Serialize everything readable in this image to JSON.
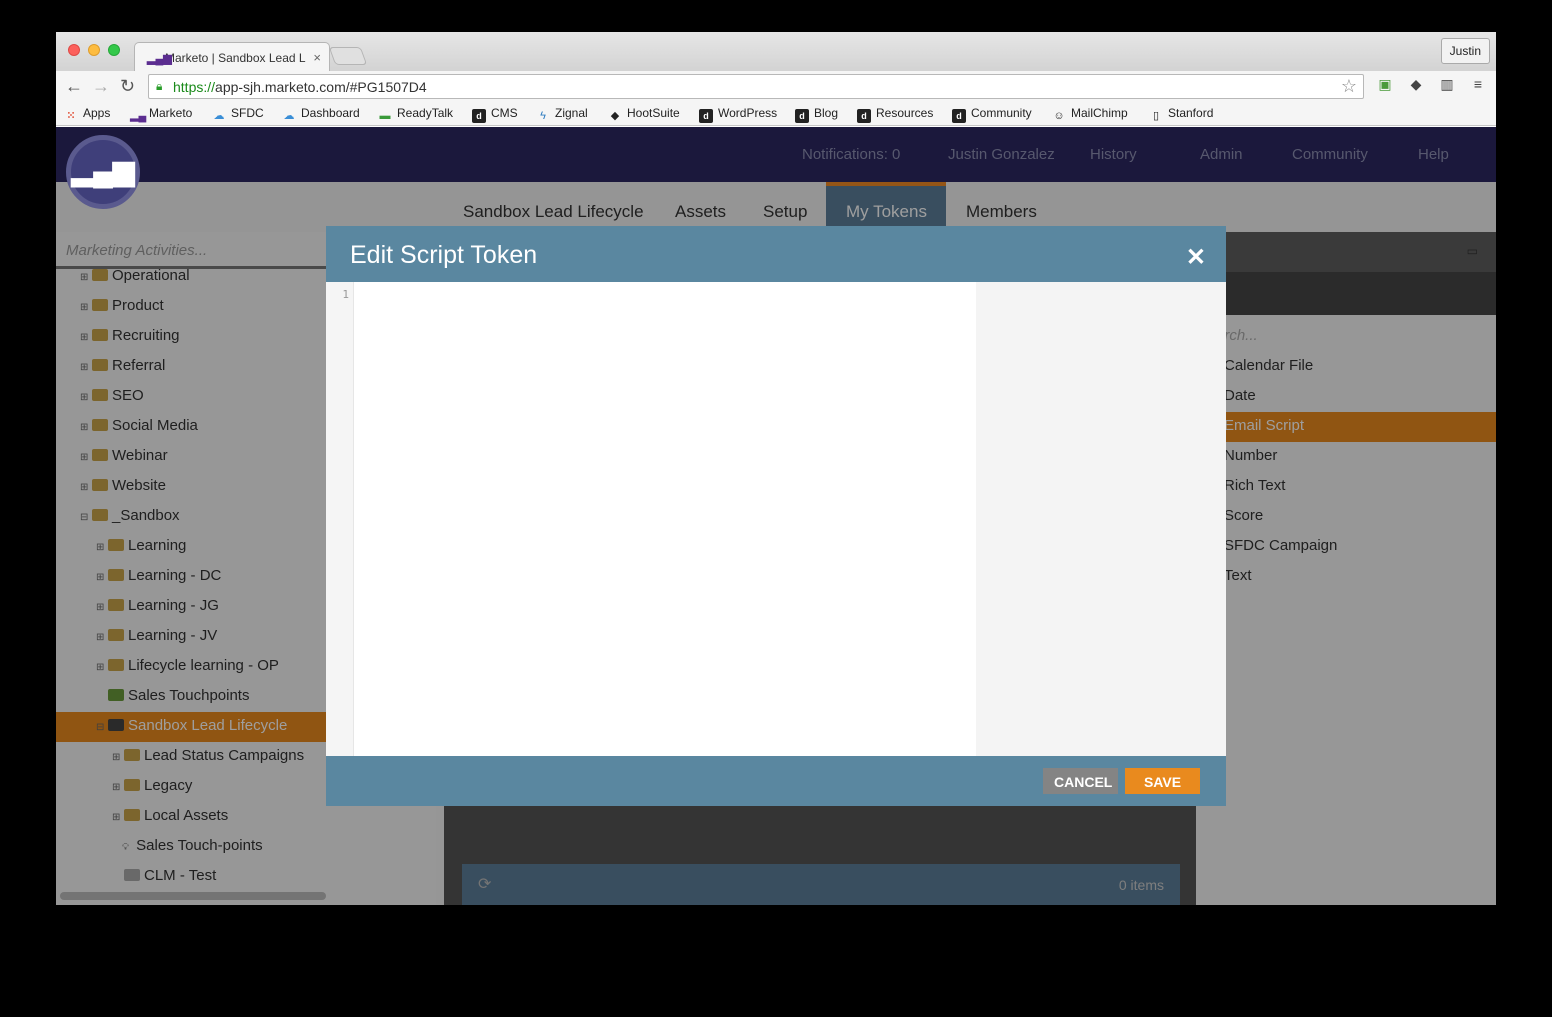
{
  "browser": {
    "tab_title": "Marketo | Sandbox Lead L",
    "tab_close": "×",
    "profile": "Justin",
    "url_scheme": "https://",
    "url_rest": "app-sjh.marketo.com/#PG1507D4",
    "bookmarks": [
      "Apps",
      "Marketo",
      "SFDC",
      "Dashboard",
      "ReadyTalk",
      "CMS",
      "Zignal",
      "HootSuite",
      "WordPress",
      "Blog",
      "Resources",
      "Community",
      "MailChimp",
      "Stanford"
    ]
  },
  "topnav": {
    "notifications": "Notifications: 0",
    "user": "Justin Gonzalez",
    "history": "History",
    "admin": "Admin",
    "community": "Community",
    "help": "Help"
  },
  "mainnav": {
    "tabs": [
      "Sandbox Lead Lifecycle",
      "Assets",
      "Setup",
      "My Tokens",
      "Members"
    ]
  },
  "sidebar": {
    "search_placeholder": "Marketing Activities...",
    "items": [
      "Operational",
      "Product",
      "Recruiting",
      "Referral",
      "SEO",
      "Social Media",
      "Webinar",
      "Website",
      "_Sandbox",
      "Learning",
      "Learning - DC",
      "Learning - JG",
      "Learning - JV",
      "Lifecycle learning - OP",
      "Sales Touchpoints",
      "Sandbox Lead Lifecycle",
      "Lead Status Campaigns",
      "Legacy",
      "Local Assets",
      "Sales Touch-points",
      "CLM - Test"
    ]
  },
  "center": {
    "items_count": "0 items"
  },
  "rightpanel": {
    "search_placeholder": "arch...",
    "items": [
      "Calendar File",
      "Date",
      "Email Script",
      "Number",
      "Rich Text",
      "Score",
      "SFDC Campaign",
      "Text"
    ],
    "selected": "Email Script"
  },
  "modal": {
    "title": "Edit Script Token",
    "line_number": "1",
    "cancel": "CANCEL",
    "save": "SAVE"
  }
}
